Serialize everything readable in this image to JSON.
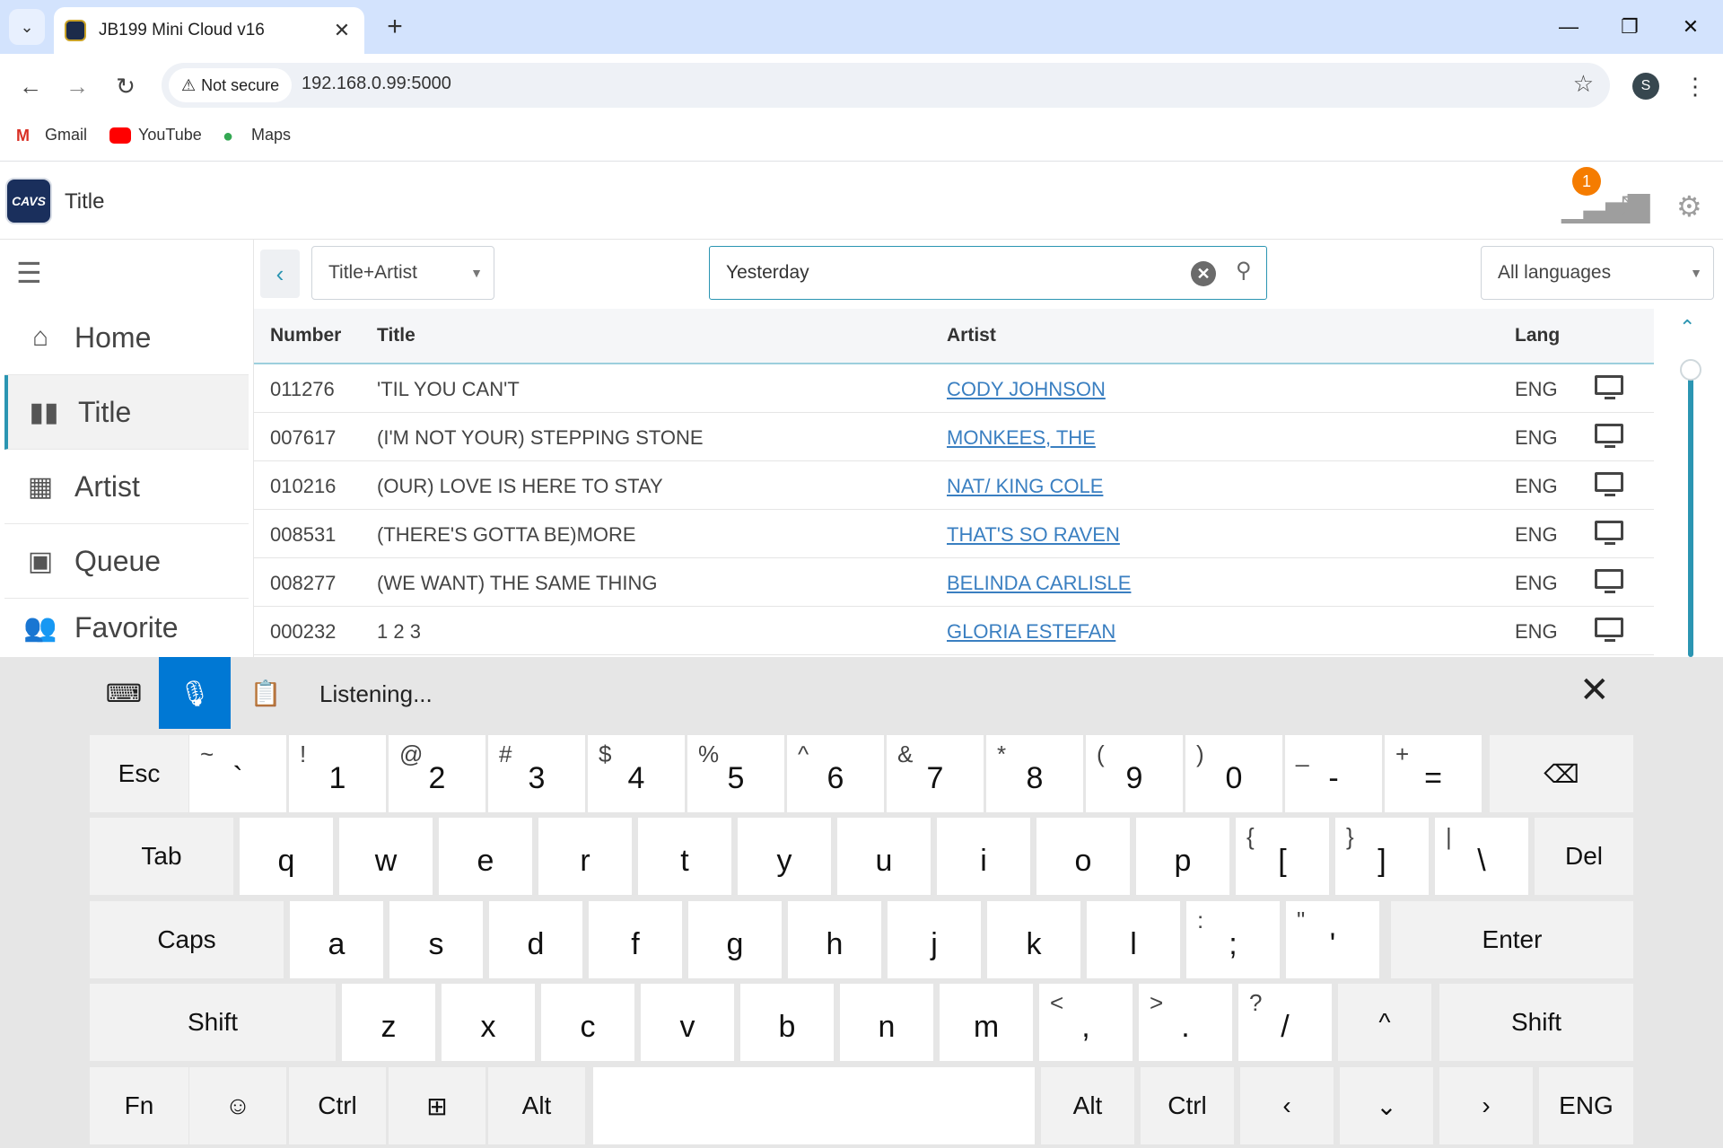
{
  "browser": {
    "tab_title": "JB199 Mini Cloud v16",
    "not_secure": "Not secure",
    "url": "192.168.0.99:5000",
    "profile_initial": "S",
    "bookmarks": [
      {
        "label": "Gmail",
        "icon": "gmail-icon"
      },
      {
        "label": "YouTube",
        "icon": "youtube-icon"
      },
      {
        "label": "Maps",
        "icon": "maps-icon"
      }
    ]
  },
  "app": {
    "logo_text": "CAVS",
    "title": "Title",
    "notification_count": "1",
    "nav": [
      "Home",
      "Title",
      "Artist",
      "Queue",
      "Favorite"
    ],
    "active_nav": "Title"
  },
  "search": {
    "mode": "Title+Artist",
    "query": "Yesterday",
    "language": "All languages"
  },
  "table": {
    "columns": [
      "Number",
      "Title",
      "Artist",
      "Lang"
    ],
    "rows": [
      [
        "011276",
        "'TIL YOU CAN'T",
        "CODY JOHNSON",
        "ENG"
      ],
      [
        "007617",
        "(I'M NOT YOUR) STEPPING STONE",
        "MONKEES, THE",
        "ENG"
      ],
      [
        "010216",
        "(OUR) LOVE IS HERE TO STAY",
        "NAT/ KING COLE",
        "ENG"
      ],
      [
        "008531",
        "(THERE'S GOTTA BE)MORE",
        "THAT'S SO RAVEN",
        "ENG"
      ],
      [
        "008277",
        "(WE WANT) THE SAME THING",
        "BELINDA CARLISLE",
        "ENG"
      ],
      [
        "000232",
        "1 2 3",
        "GLORIA ESTEFAN",
        "ENG"
      ]
    ]
  },
  "keyboard": {
    "status": "Listening...",
    "rows": [
      [
        [
          "Esc",
          ""
        ],
        [
          "`",
          "~"
        ],
        [
          "1",
          "!"
        ],
        [
          "2",
          "@"
        ],
        [
          "3",
          "#"
        ],
        [
          "4",
          "$"
        ],
        [
          "5",
          "%"
        ],
        [
          "6",
          "^"
        ],
        [
          "7",
          "&"
        ],
        [
          "8",
          "*"
        ],
        [
          "9",
          "("
        ],
        [
          "0",
          ")"
        ],
        [
          "-",
          "_"
        ],
        [
          "=",
          "+"
        ],
        [
          "⌫",
          ""
        ]
      ],
      [
        [
          "Tab",
          ""
        ],
        [
          "q",
          ""
        ],
        [
          "w",
          ""
        ],
        [
          "e",
          ""
        ],
        [
          "r",
          ""
        ],
        [
          "t",
          ""
        ],
        [
          "y",
          ""
        ],
        [
          "u",
          ""
        ],
        [
          "i",
          ""
        ],
        [
          "o",
          ""
        ],
        [
          "p",
          ""
        ],
        [
          "[",
          "{"
        ],
        [
          "]",
          "}"
        ],
        [
          "\\",
          "|"
        ],
        [
          "Del",
          ""
        ]
      ],
      [
        [
          "Caps",
          ""
        ],
        [
          "a",
          ""
        ],
        [
          "s",
          ""
        ],
        [
          "d",
          ""
        ],
        [
          "f",
          ""
        ],
        [
          "g",
          ""
        ],
        [
          "h",
          ""
        ],
        [
          "j",
          ""
        ],
        [
          "k",
          ""
        ],
        [
          "l",
          ""
        ],
        [
          ";",
          ":"
        ],
        [
          "'",
          "\""
        ],
        [
          "Enter",
          ""
        ]
      ],
      [
        [
          "Shift",
          ""
        ],
        [
          "z",
          ""
        ],
        [
          "x",
          ""
        ],
        [
          "c",
          ""
        ],
        [
          "v",
          ""
        ],
        [
          "b",
          ""
        ],
        [
          "n",
          ""
        ],
        [
          "m",
          ""
        ],
        [
          ",",
          "<"
        ],
        [
          ".",
          ">"
        ],
        [
          "/",
          "?"
        ],
        [
          "^",
          ""
        ],
        [
          "Shift",
          ""
        ]
      ],
      [
        [
          "Fn",
          ""
        ],
        [
          "☺",
          ""
        ],
        [
          "Ctrl",
          ""
        ],
        [
          "⊞",
          ""
        ],
        [
          "Alt",
          ""
        ],
        [
          "",
          ""
        ],
        [
          "Alt",
          ""
        ],
        [
          "Ctrl",
          ""
        ],
        [
          "‹",
          ""
        ],
        [
          "⌄",
          ""
        ],
        [
          "›",
          ""
        ],
        [
          "ENG",
          ""
        ]
      ]
    ]
  }
}
